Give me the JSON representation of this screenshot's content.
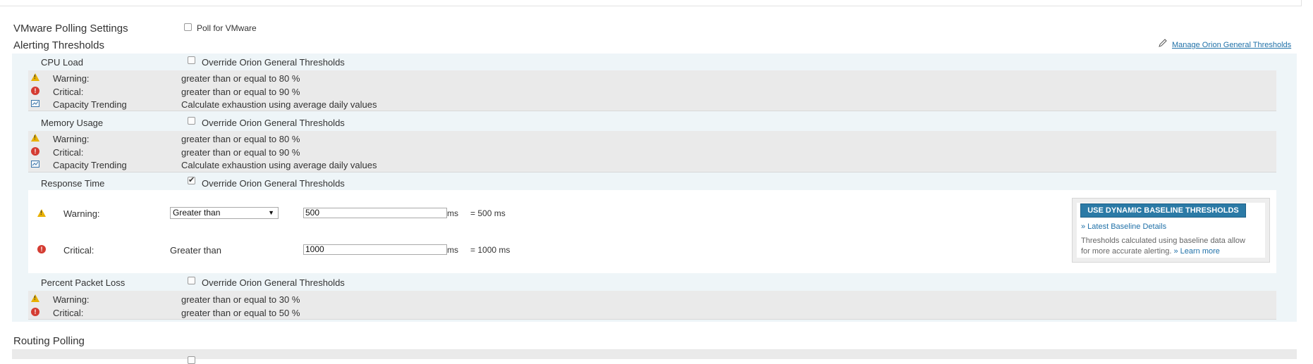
{
  "vmware": {
    "title": "VMware Polling Settings",
    "poll_label": "Poll for VMware",
    "poll_checked": false
  },
  "alerting": {
    "title": "Alerting Thresholds",
    "manage_link": "Manage Orion General Thresholds",
    "override_label": "Override Orion General Thresholds",
    "cpu": {
      "name": "CPU Load",
      "override_checked": false,
      "warning_label": "Warning:",
      "warning_value": "greater than or equal to 80 %",
      "critical_label": "Critical:",
      "critical_value": "greater than or equal to 90 %",
      "trend_label": "Capacity Trending",
      "trend_value": "Calculate exhaustion using average daily values"
    },
    "memory": {
      "name": "Memory Usage",
      "override_checked": false,
      "warning_label": "Warning:",
      "warning_value": "greater than or equal to 80 %",
      "critical_label": "Critical:",
      "critical_value": "greater than or equal to 90 %",
      "trend_label": "Capacity Trending",
      "trend_value": "Calculate exhaustion using average daily values"
    },
    "response": {
      "name": "Response Time",
      "override_checked": true,
      "warning_label": "Warning:",
      "warning_operator": "Greater than",
      "warning_input": "500",
      "warning_unit": "ms",
      "warning_result": "= 500 ms",
      "critical_label": "Critical:",
      "critical_operator": "Greater than",
      "critical_input": "1000",
      "critical_unit": "ms",
      "critical_result": "= 1000 ms",
      "baseline_button": "USE DYNAMIC BASELINE THRESHOLDS",
      "baseline_details_link": "» Latest Baseline Details",
      "baseline_desc_1": "Thresholds calculated using baseline data allow",
      "baseline_desc_2": "for more accurate alerting.",
      "learn_more": "» Learn more"
    },
    "packet": {
      "name": "Percent Packet Loss",
      "override_checked": false,
      "warning_label": "Warning:",
      "warning_value": "greater than or equal to 30 %",
      "critical_label": "Critical:",
      "critical_value": "greater than or equal to 50 %"
    }
  },
  "routing": {
    "title": "Routing Polling"
  },
  "colors": {
    "link": "#2071a8",
    "button": "#2b7aa6",
    "warning": "#e8b000",
    "critical": "#d43c32",
    "band": "#eef5f8",
    "gray_row": "#eaeaea"
  }
}
